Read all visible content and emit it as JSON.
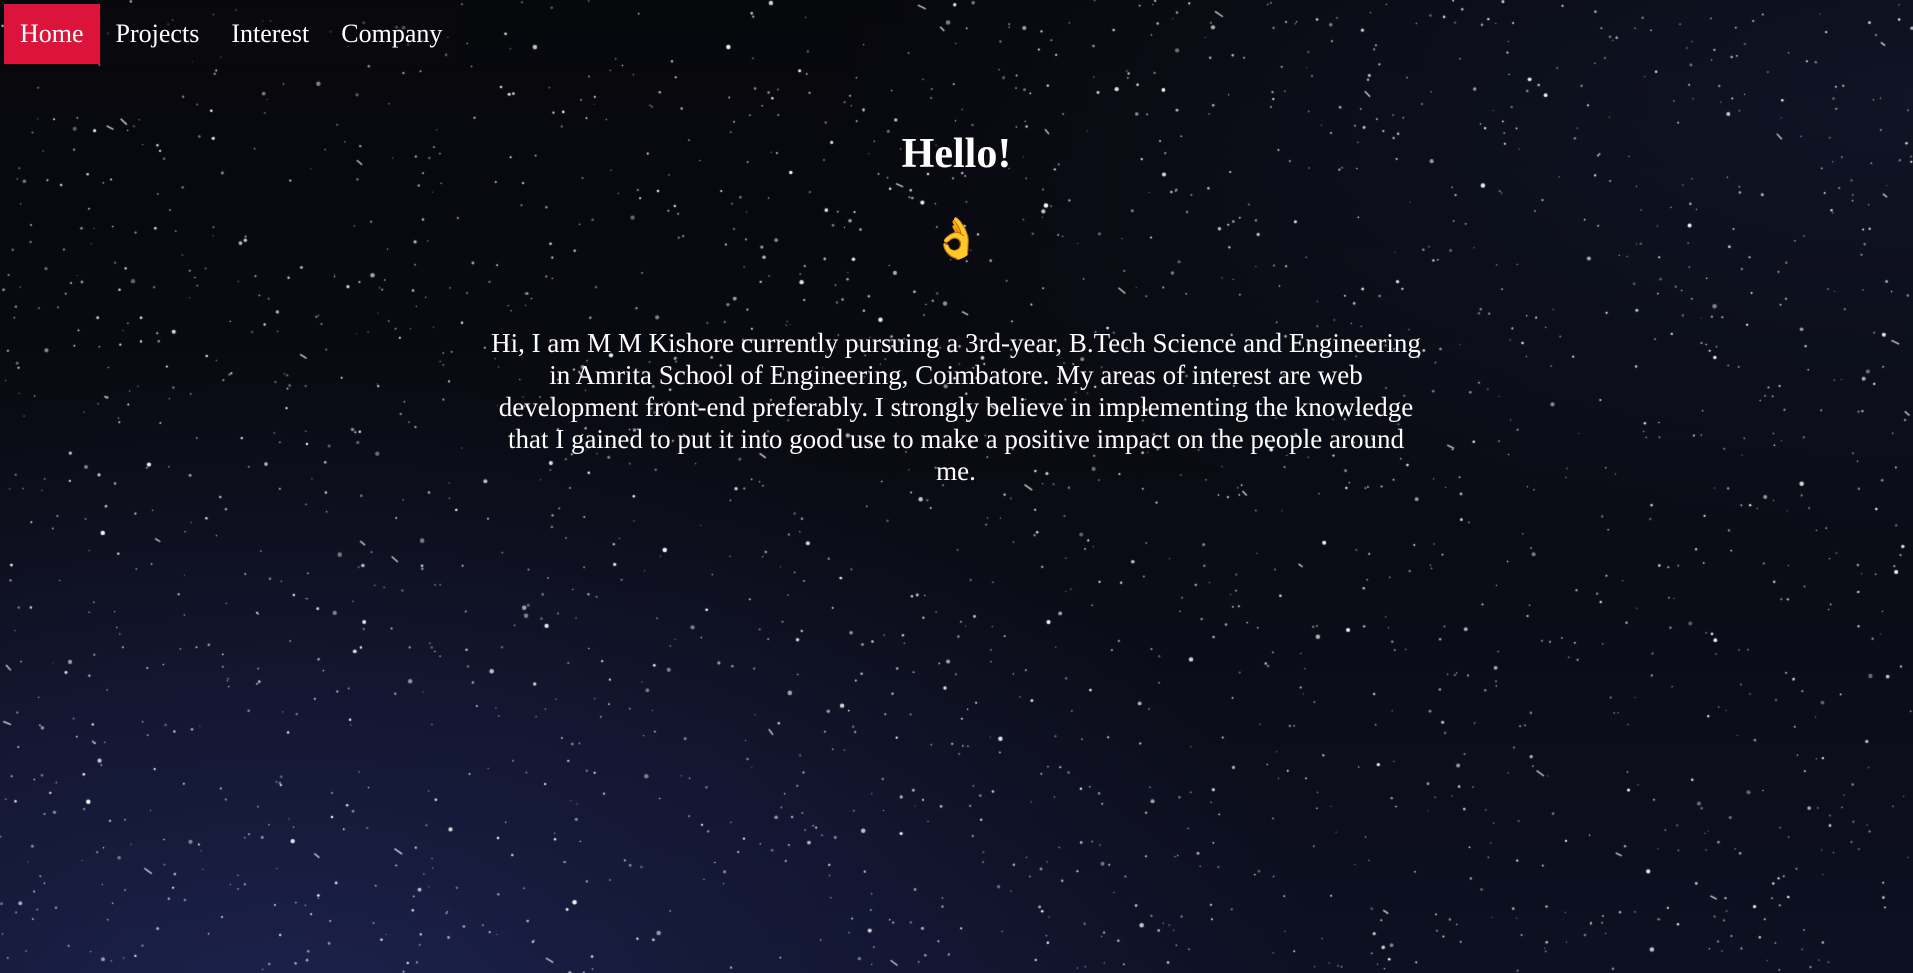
{
  "nav": {
    "items": [
      {
        "label": "Home",
        "active": true
      },
      {
        "label": "Projects",
        "active": false
      },
      {
        "label": "Interest",
        "active": false
      },
      {
        "label": "Company",
        "active": false
      }
    ]
  },
  "main": {
    "heading": "Hello!",
    "emoji": "👌",
    "bio": "Hi, I am M M Kishore currently pursuing a 3rd-year, B.Tech Science and Engineering in Amrita School of Engineering, Coimbatore. My areas of interest are web development front-end preferably. I strongly believe in implementing the knowledge that I gained to put it into good use to make a positive impact on the people around me."
  },
  "colors": {
    "active_nav": "#dc143c",
    "background": "#07080c",
    "text": "#ffffff"
  }
}
